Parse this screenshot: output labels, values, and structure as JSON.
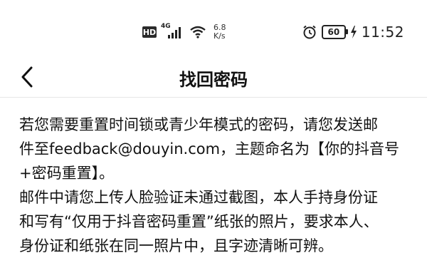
{
  "status_bar": {
    "hd_label": "HD",
    "network_label": "4G",
    "speed_value": "6.8",
    "speed_unit": "K/s",
    "battery_level": "60",
    "time": "11:52"
  },
  "nav": {
    "title": "找回密码"
  },
  "content": {
    "paragraph_1_lines": [
      "若您需要重置时间锁或青少年模式的密码，请您发送邮",
      "件至feedback@douyin.com，主题命名为【你的抖音号",
      "+密码重置】。"
    ],
    "paragraph_2_lines": [
      "邮件中请您上传人脸验证未通过截图，本人手持身份证",
      "和写有“仅用于抖音密码重置”纸张的照片，要求本人、",
      "身份证和纸张在同一照片中，且字迹清晰可辨。"
    ]
  }
}
